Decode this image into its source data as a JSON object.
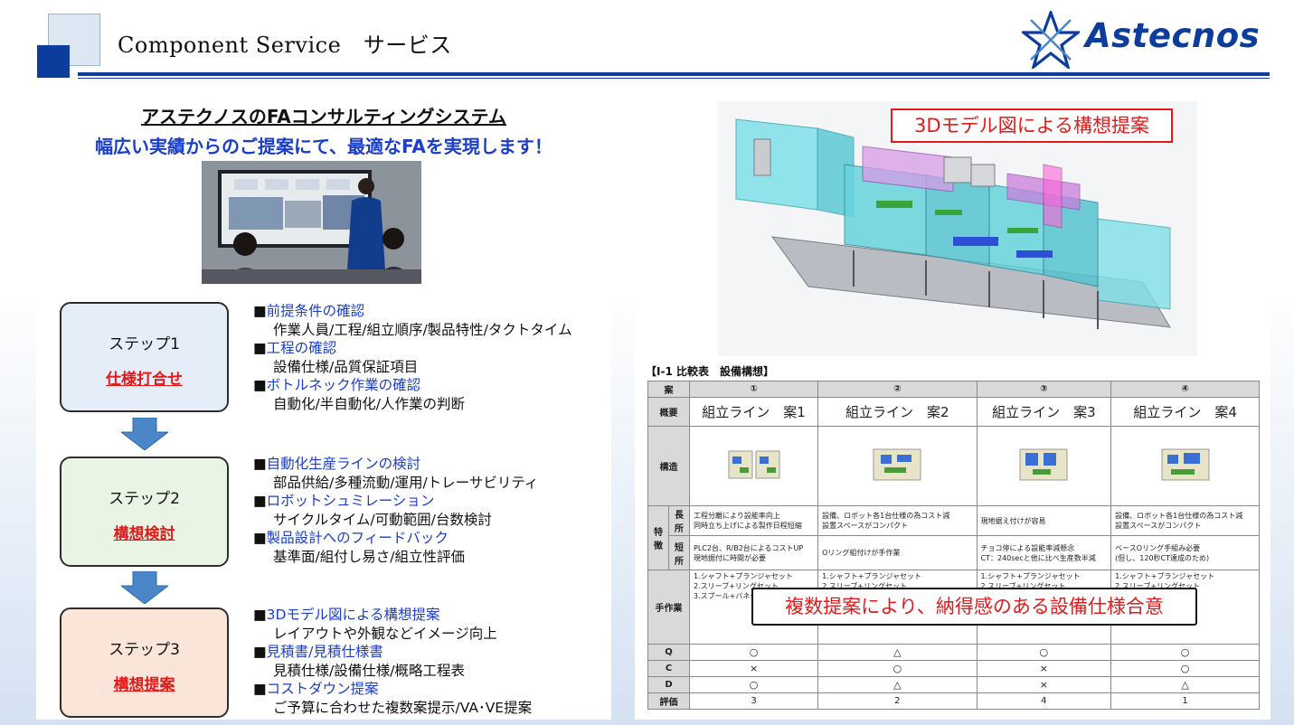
{
  "header": {
    "title": "Component Service　サービス",
    "logo_text": "Astecnos",
    "brand_color": "#0c3c9c"
  },
  "left": {
    "title": "アステクノスのFAコンサルティングシステム",
    "subtitle": "幅広い実績からのご提案にて、最適なFAを実現します！",
    "steps": [
      {
        "label": "ステップ1",
        "name": "仕様打合せ",
        "bg": "#e4edf8",
        "items": [
          {
            "head": "前提条件の確認",
            "detail": "作業人員/工程/組立順序/製品特性/タクトタイム"
          },
          {
            "head": "工程の確認",
            "detail": "設備仕様/品質保証項目"
          },
          {
            "head": "ボトルネック作業の確認",
            "detail": "自動化/半自動化/人作業の判断"
          }
        ]
      },
      {
        "label": "ステップ2",
        "name": "構想検討",
        "bg": "#e9f4e4",
        "items": [
          {
            "head": "自動化生産ラインの検討",
            "detail": "部品供給/多種流動/運用/トレーサビリティ"
          },
          {
            "head": "ロボットシュミレーション",
            "detail": "サイクルタイム/可動範囲/台数検討"
          },
          {
            "head": "製品設計へのフィードバック",
            "detail": "基準面/組付し易さ/組立性評価"
          }
        ]
      },
      {
        "label": "ステップ3",
        "name": "構想提案",
        "bg": "#fbe4d8",
        "items": [
          {
            "head": "3Dモデル図による構想提案",
            "detail": "レイアウトや外観などイメージ向上"
          },
          {
            "head": "見積書/見積仕様書",
            "detail": "見積仕様/設備仕様/概略工程表"
          },
          {
            "head": "コストダウン提案",
            "detail": "ご予算に合わせた複数案提示/VA･VE提案"
          }
        ]
      }
    ]
  },
  "right": {
    "render_label": "3Dモデル図による構想提案",
    "table_title": "【Ⅰ-1 比較表　設備構想】",
    "callout": "複数提案により、納得感のある設備仕様合意",
    "table": {
      "col_head": "案",
      "cols": [
        "①",
        "②",
        "③",
        "④"
      ],
      "overview_label": "概要",
      "overview": [
        "組立ライン　案1",
        "組立ライン　案2",
        "組立ライン　案3",
        "組立ライン　案4"
      ],
      "structure_label": "構造",
      "feature_label": "特徴",
      "merit_label": "長所",
      "demerit_label": "短所",
      "merits": [
        "工程分離により設能率向上\n同時立ち上げによる製作日程短縮",
        "設備、ロボット各1台仕様の為コスト減\n設置スペースがコンパクト",
        "現地据え付けが容易",
        "設備、ロボット各1台仕様の為コスト減\n設置スペースがコンパクト"
      ],
      "demerits": [
        "PLC2台、R/B2台によるコストUP\n現地据付に時間が必要",
        "Oリング組付けが手作業",
        "チョコ停による設能率減懸念\nCT：240secと他に比べ生産数半減",
        "ベースOリング手組み必要\n(但し、120秒CT達成のため)"
      ],
      "manual_label": "手作業",
      "manual": [
        "1.シャフト+プランジャセット\n2.スリーブ+リングセット\n3.スプール+バネセット",
        "1.シャフト+プランジャセット\n2.スリーブ+リングセット\n6.スリーブSUBASSY+スプールSUBASSY\n組付",
        "1.シャフト+プランジャセット\n2.スリーブ+リングセット",
        "1.シャフト+プランジャセット\n2.スリーブ+リングセット"
      ],
      "rows": [
        {
          "label": "Q",
          "values": [
            "○",
            "△",
            "○",
            "○"
          ]
        },
        {
          "label": "C",
          "values": [
            "×",
            "○",
            "×",
            "○"
          ]
        },
        {
          "label": "D",
          "values": [
            "○",
            "△",
            "×",
            "△"
          ]
        },
        {
          "label": "評価",
          "values": [
            "3",
            "2",
            "4",
            "1"
          ]
        }
      ]
    }
  },
  "colors": {
    "accent_blue": "#1a3ec8",
    "red": "#e21a1a",
    "arrow": "#4a86c8"
  }
}
